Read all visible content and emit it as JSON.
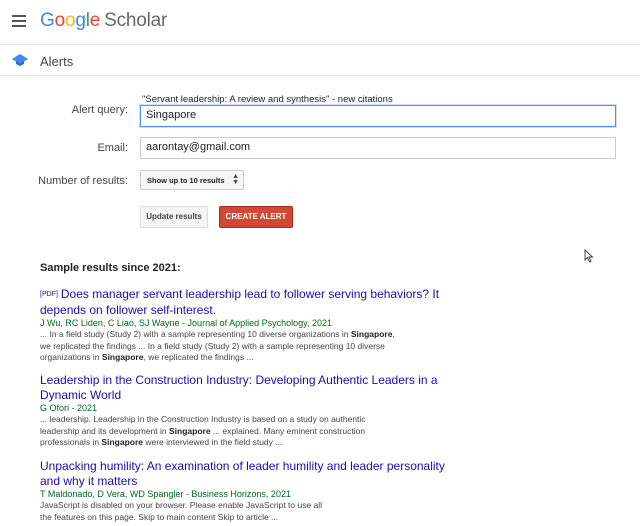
{
  "header": {
    "logo_google": "Google",
    "logo_scholar": "Scholar",
    "menu_icon": "hamburger-menu-icon"
  },
  "subheader": {
    "icon": "graduation-cap-icon",
    "title": "Alerts"
  },
  "form": {
    "alert_query_label": "Alert query:",
    "query_description": "\"Servant leadership: A review and synthesis\" - new citations",
    "alert_query_value": "Singapore",
    "email_label": "Email:",
    "email_value": "aarontay@gmail.com",
    "results_label": "Number of results:",
    "results_select": "Show up to 10 results",
    "update_button": "Update results",
    "create_button": "CREATE ALERT"
  },
  "colors": {
    "create_button": "#d14836",
    "link": "#1a0dab",
    "authors": "#006621",
    "focus_border": "#4d90fe"
  },
  "sample": {
    "heading": "Sample results since 2021:",
    "results": [
      {
        "pdf_tag": "[PDF]",
        "title": "Does manager servant leadership lead to follower serving behaviors? It depends on follower self-interest.",
        "authors": "J Wu, RC Liden, C Liao, SJ Wayne - Journal of Applied Psychology, 2021",
        "snippet": [
          [
            "... In a field study (Study 2) with a sample representing 10 diverse organizations in ",
            false
          ],
          [
            "Singapore",
            true
          ],
          [
            ",",
            false
          ],
          [
            "\nwe replicated the findings ... In a field study (Study 2) with a sample representing 10 diverse\norganizations in ",
            false
          ],
          [
            "Singapore",
            true
          ],
          [
            ", we replicated the findings ...",
            false
          ]
        ]
      },
      {
        "pdf_tag": "",
        "title": "Leadership in the Construction Industry: Developing Authentic Leaders in a Dynamic World",
        "authors": "G Ofori - 2021",
        "snippet": [
          [
            "... leadership. Leadership in the Construction Industry is based on a study on authentic\nleadership and its development in ",
            false
          ],
          [
            "Singapore",
            true
          ],
          [
            " ... explained. Many eminent construction\nprofessionals in ",
            false
          ],
          [
            "Singapore",
            true
          ],
          [
            " were interviewed in the field study ...",
            false
          ]
        ]
      },
      {
        "pdf_tag": "",
        "title": "Unpacking humility: An examination of leader humility and leader personality and why it matters",
        "authors": "T Maldonado, D Vera, WD Spangler - Business Horizons, 2021",
        "snippet": [
          [
            "JavaScript is disabled on your browser. Please enable JavaScript to use all\nthe features on this page. Skip to main content Skip to article ...",
            false
          ]
        ]
      }
    ]
  }
}
